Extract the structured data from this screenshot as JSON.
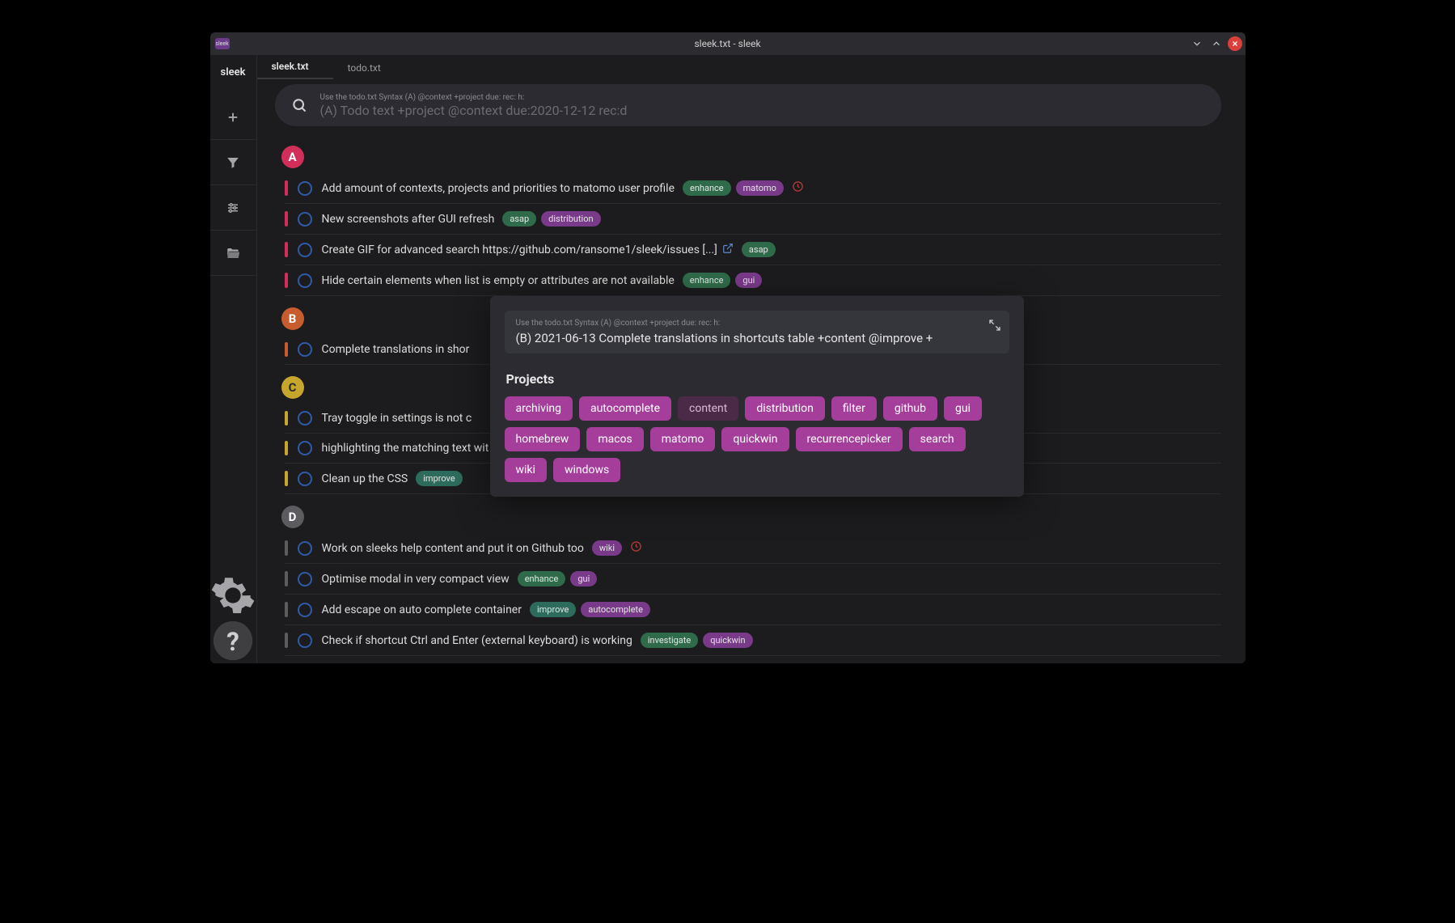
{
  "titlebar": {
    "title": "sleek.txt - sleek",
    "app_icon_label": "sleek"
  },
  "sidebar": {
    "brand": "sleek"
  },
  "tabs": [
    {
      "label": "sleek.txt",
      "active": true
    },
    {
      "label": "todo.txt",
      "active": false
    }
  ],
  "search": {
    "hint": "Use the todo.txt Syntax (A) @context +project due: rec: h:",
    "placeholder": "(A) Todo text +project @context due:2020-12-12 rec:d"
  },
  "priorities": {
    "A": {
      "label": "A"
    },
    "B": {
      "label": "B"
    },
    "C": {
      "label": "C"
    },
    "D": {
      "label": "D"
    }
  },
  "todos": {
    "A": [
      {
        "text": "Add amount of contexts, projects and priorities to matomo user profile",
        "tags": [
          {
            "t": "enhance",
            "c": "green"
          },
          {
            "t": "matomo",
            "c": "purple"
          }
        ],
        "clock": true
      },
      {
        "text": "New screenshots after GUI refresh",
        "tags": [
          {
            "t": "asap",
            "c": "green"
          },
          {
            "t": "distribution",
            "c": "purple"
          }
        ]
      },
      {
        "text": "Create GIF for advanced search https://github.com/ransome1/sleek/issues [...]",
        "ext": true,
        "tags": [
          {
            "t": "asap",
            "c": "green"
          }
        ]
      },
      {
        "text": "Hide certain elements when list is empty or attributes are not available",
        "tags": [
          {
            "t": "enhance",
            "c": "green"
          },
          {
            "t": "gui",
            "c": "purple"
          }
        ]
      }
    ],
    "B": [
      {
        "text": "Complete translations in shor"
      }
    ],
    "C": [
      {
        "text": "Tray toggle in settings is not c"
      },
      {
        "text": "highlighting the matching text wit"
      },
      {
        "text": "Clean up the CSS",
        "tags": [
          {
            "t": "improve",
            "c": "teal"
          }
        ]
      }
    ],
    "D": [
      {
        "text": "Work on sleeks help content and put it on Github too",
        "tags": [
          {
            "t": "wiki",
            "c": "purple"
          }
        ],
        "clock": true
      },
      {
        "text": "Optimise modal in very compact view",
        "tags": [
          {
            "t": "enhance",
            "c": "green"
          },
          {
            "t": "gui",
            "c": "purple"
          }
        ]
      },
      {
        "text": "Add escape on auto complete container",
        "tags": [
          {
            "t": "improve",
            "c": "teal"
          },
          {
            "t": "autocomplete",
            "c": "purple"
          }
        ]
      },
      {
        "text": "Check if shortcut Ctrl and Enter (external keyboard) is working",
        "tags": [
          {
            "t": "investigate",
            "c": "green"
          },
          {
            "t": "quickwin",
            "c": "purple"
          }
        ]
      }
    ]
  },
  "modal": {
    "hint": "Use the todo.txt Syntax (A) @context +project due: rec: h:",
    "text": "(B) 2021-06-13 Complete translations in shortcuts table +content @improve +",
    "section": "Projects",
    "projects": [
      {
        "t": "archiving"
      },
      {
        "t": "autocomplete"
      },
      {
        "t": "content",
        "sel": true
      },
      {
        "t": "distribution"
      },
      {
        "t": "filter"
      },
      {
        "t": "github"
      },
      {
        "t": "gui"
      },
      {
        "t": "homebrew"
      },
      {
        "t": "macos"
      },
      {
        "t": "matomo"
      },
      {
        "t": "quickwin"
      },
      {
        "t": "recurrencepicker"
      },
      {
        "t": "search"
      },
      {
        "t": "wiki"
      },
      {
        "t": "windows"
      }
    ]
  }
}
